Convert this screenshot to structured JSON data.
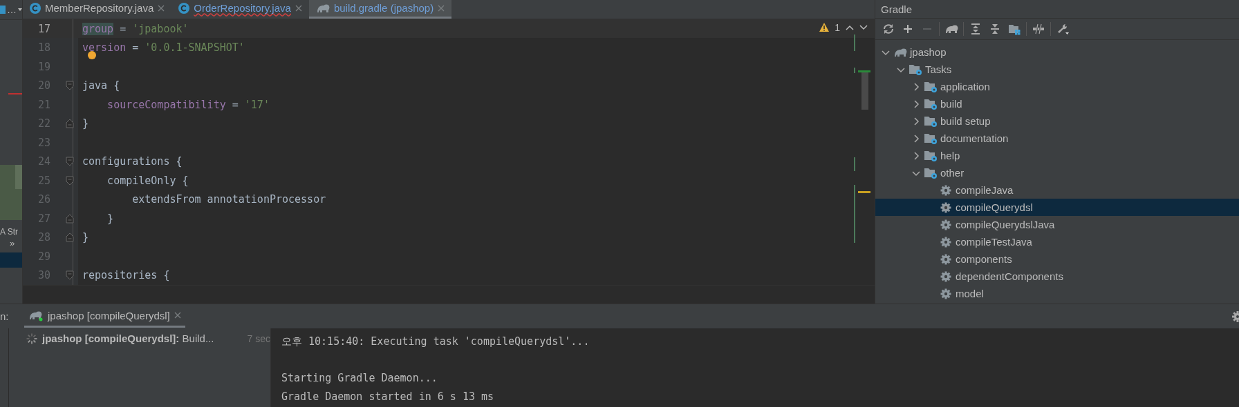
{
  "left_strip": {
    "labels": [
      {
        "text": "…",
        "kind": "menu"
      },
      {
        "text": "A Str",
        "kind": "tab"
      },
      {
        "text": "»",
        "kind": "more"
      }
    ]
  },
  "editor_tabs": [
    {
      "label": "MemberRepository.java",
      "kind": "class",
      "selected": false,
      "error": false
    },
    {
      "label": "OrderRepository.java",
      "kind": "class",
      "selected": false,
      "error": true
    },
    {
      "label": "build.gradle (jpashop)",
      "kind": "gradle",
      "selected": true,
      "error": false
    }
  ],
  "editor": {
    "warning_count": "1",
    "lines": [
      {
        "number": "17",
        "current": true,
        "kind": "plain",
        "tokens": [
          {
            "text": "group",
            "kind": "prop",
            "highlighted": true
          },
          {
            "text": " = ",
            "kind": "plain"
          },
          {
            "text": "'jpabook'",
            "kind": "string"
          }
        ]
      },
      {
        "number": "18",
        "current": false,
        "kind": "plain",
        "tokens": [
          {
            "text": "version",
            "kind": "prop"
          },
          {
            "text": " = ",
            "kind": "plain"
          },
          {
            "text": "'0.0.1-SNAPSHOT'",
            "kind": "string"
          }
        ]
      },
      {
        "number": "19",
        "current": false,
        "kind": "plain"
      },
      {
        "number": "20",
        "current": false,
        "kind": "fold-start",
        "tokens": [
          {
            "text": "java {",
            "kind": "plain"
          }
        ]
      },
      {
        "number": "21",
        "current": false,
        "kind": "plain",
        "tokens": [
          {
            "text": "    sourceCompatibility",
            "kind": "prop"
          },
          {
            "text": " = ",
            "kind": "plain"
          },
          {
            "text": "'17'",
            "kind": "string"
          }
        ]
      },
      {
        "number": "22",
        "current": false,
        "kind": "fold-end",
        "tokens": [
          {
            "text": "}",
            "kind": "plain"
          }
        ]
      },
      {
        "number": "23",
        "current": false,
        "kind": "plain"
      },
      {
        "number": "24",
        "current": false,
        "kind": "fold-start",
        "tokens": [
          {
            "text": "configurations {",
            "kind": "plain"
          }
        ]
      },
      {
        "number": "25",
        "current": false,
        "kind": "fold-start",
        "tokens": [
          {
            "text": "    compileOnly {",
            "kind": "plain"
          }
        ]
      },
      {
        "number": "26",
        "current": false,
        "kind": "plain",
        "tokens": [
          {
            "text": "        extendsFrom annotationProcessor",
            "kind": "plain"
          }
        ]
      },
      {
        "number": "27",
        "current": false,
        "kind": "fold-end",
        "tokens": [
          {
            "text": "    }",
            "kind": "plain"
          }
        ]
      },
      {
        "number": "28",
        "current": false,
        "kind": "fold-end",
        "tokens": [
          {
            "text": "}",
            "kind": "plain"
          }
        ]
      },
      {
        "number": "29",
        "current": false,
        "kind": "plain"
      },
      {
        "number": "30",
        "current": false,
        "kind": "fold-start",
        "tokens": [
          {
            "text": "repositories {",
            "kind": "plain"
          }
        ]
      }
    ]
  },
  "gradle": {
    "title": "Gradle",
    "tree": [
      {
        "label": "jpashop",
        "kind": "project",
        "expanded": true,
        "selected": false,
        "children": [
          {
            "label": "Tasks",
            "kind": "folder",
            "expanded": true,
            "selected": false,
            "children": [
              {
                "label": "application",
                "kind": "folder",
                "expanded": false,
                "selected": false
              },
              {
                "label": "build",
                "kind": "folder",
                "expanded": false,
                "selected": false
              },
              {
                "label": "build setup",
                "kind": "folder",
                "expanded": false,
                "selected": false
              },
              {
                "label": "documentation",
                "kind": "folder",
                "expanded": false,
                "selected": false
              },
              {
                "label": "help",
                "kind": "folder",
                "expanded": false,
                "selected": false
              },
              {
                "label": "other",
                "kind": "folder",
                "expanded": true,
                "selected": false,
                "children": [
                  {
                    "label": "compileJava",
                    "kind": "task",
                    "selected": false
                  },
                  {
                    "label": "compileQuerydsl",
                    "kind": "task",
                    "selected": true
                  },
                  {
                    "label": "compileQuerydslJava",
                    "kind": "task",
                    "selected": false
                  },
                  {
                    "label": "compileTestJava",
                    "kind": "task",
                    "selected": false
                  },
                  {
                    "label": "components",
                    "kind": "task",
                    "selected": false
                  },
                  {
                    "label": "dependentComponents",
                    "kind": "task",
                    "selected": false
                  },
                  {
                    "label": "model",
                    "kind": "task",
                    "selected": false
                  }
                ]
              }
            ]
          }
        ]
      }
    ]
  },
  "run_panel": {
    "label": "n:",
    "tab": {
      "title": "jpashop [compileQuerydsl]",
      "selected": true
    },
    "build_item": {
      "text": "**jpashop [compileQuerydsl]:** Build...",
      "time": "7 sec"
    },
    "console": [
      {
        "text": "오후 10:15:40: Executing task 'compileQuerydsl'...",
        "kind": "text"
      },
      {
        "kind": "blank"
      },
      {
        "text": "Starting Gradle Daemon...",
        "kind": "text"
      },
      {
        "text": "Gradle Daemon started in 6 s 13 ms",
        "kind": "text"
      }
    ]
  }
}
